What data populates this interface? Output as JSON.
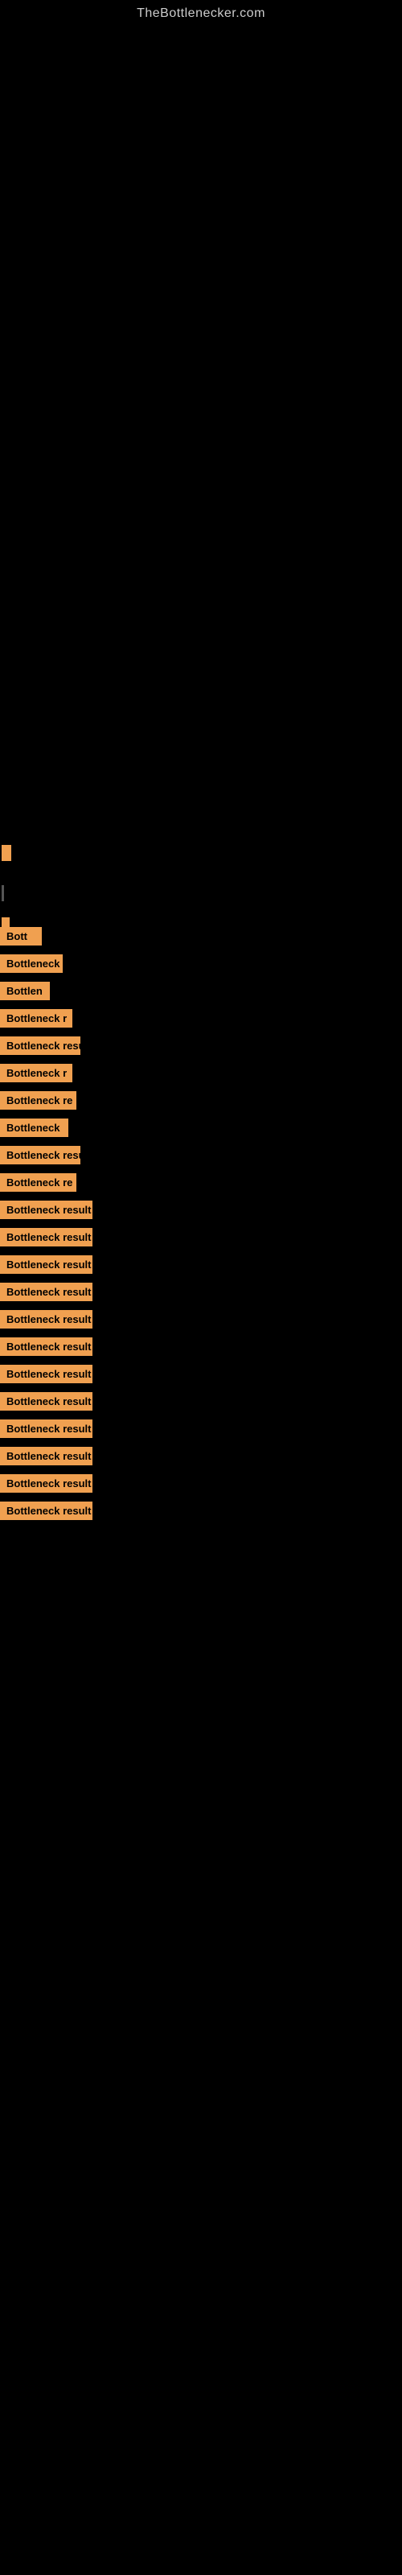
{
  "header": {
    "site_title": "TheBottlenecker.com"
  },
  "indicators": {
    "orange_block": "▮",
    "gray_bar": "|"
  },
  "bottleneck_items": [
    {
      "id": 1,
      "label": "Bott",
      "css_class": "item-1"
    },
    {
      "id": 2,
      "label": "Bottleneck",
      "css_class": "item-2"
    },
    {
      "id": 3,
      "label": "Bottlen",
      "css_class": "item-3"
    },
    {
      "id": 4,
      "label": "Bottleneck r",
      "css_class": "item-4"
    },
    {
      "id": 5,
      "label": "Bottleneck resu",
      "css_class": "item-5"
    },
    {
      "id": 6,
      "label": "Bottleneck r",
      "css_class": "item-6"
    },
    {
      "id": 7,
      "label": "Bottleneck re",
      "css_class": "item-7"
    },
    {
      "id": 8,
      "label": "Bottleneck",
      "css_class": "item-8"
    },
    {
      "id": 9,
      "label": "Bottleneck resu",
      "css_class": "item-9"
    },
    {
      "id": 10,
      "label": "Bottleneck re",
      "css_class": "item-10"
    },
    {
      "id": 11,
      "label": "Bottleneck result",
      "css_class": "item-11"
    },
    {
      "id": 12,
      "label": "Bottleneck result",
      "css_class": "item-12"
    },
    {
      "id": 13,
      "label": "Bottleneck result",
      "css_class": "item-13"
    },
    {
      "id": 14,
      "label": "Bottleneck result",
      "css_class": "item-14"
    },
    {
      "id": 15,
      "label": "Bottleneck result",
      "css_class": "item-15"
    },
    {
      "id": 16,
      "label": "Bottleneck result",
      "css_class": "item-16"
    },
    {
      "id": 17,
      "label": "Bottleneck result",
      "css_class": "item-17"
    },
    {
      "id": 18,
      "label": "Bottleneck result",
      "css_class": "item-18"
    },
    {
      "id": 19,
      "label": "Bottleneck result",
      "css_class": "item-19"
    },
    {
      "id": 20,
      "label": "Bottleneck result",
      "css_class": "item-20"
    },
    {
      "id": 21,
      "label": "Bottleneck result",
      "css_class": "item-21"
    },
    {
      "id": 22,
      "label": "Bottleneck result",
      "css_class": "item-22"
    }
  ]
}
